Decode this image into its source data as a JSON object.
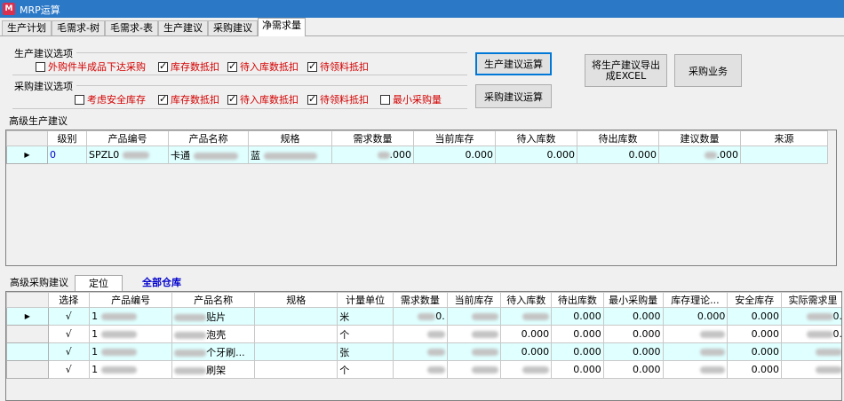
{
  "window": {
    "title": "MRP运算",
    "logo": "M"
  },
  "tabs": [
    "生产计划",
    "毛需求-树",
    "毛需求-表",
    "生产建议",
    "采购建议",
    "净需求量"
  ],
  "active_tab": 5,
  "production_options": {
    "label": "生产建议选项",
    "items": [
      {
        "label": "外购件半成品下达采购",
        "checked": false
      },
      {
        "label": "库存数抵扣",
        "checked": true
      },
      {
        "label": "待入库数抵扣",
        "checked": true
      },
      {
        "label": "待领料抵扣",
        "checked": true
      }
    ]
  },
  "purchase_options": {
    "label": "采购建议选项",
    "items": [
      {
        "label": "考虑安全库存",
        "checked": false
      },
      {
        "label": "库存数抵扣",
        "checked": true
      },
      {
        "label": "待入库数抵扣",
        "checked": true
      },
      {
        "label": "待领料抵扣",
        "checked": true
      },
      {
        "label": "最小采购量",
        "checked": false
      }
    ]
  },
  "buttons": {
    "prod_calc": "生产建议运算",
    "purch_calc": "采购建议运算",
    "export_line1": "将生产建议导出",
    "export_line2": "成EXCEL",
    "purchase_biz": "采购业务"
  },
  "prod_grid": {
    "title": "高级生产建议",
    "columns": [
      "级别",
      "产品编号",
      "产品名称",
      "规格",
      "需求数量",
      "当前库存",
      "待入库数",
      "待出库数",
      "建议数量",
      "来源"
    ],
    "rows": [
      {
        "level": "0",
        "code": "SPZL0",
        "name": "卡通",
        "spec": "蓝",
        "demand": ".000",
        "stock": "0.000",
        "in": "0.000",
        "out": "0.000",
        "advice": ".000",
        "source": ""
      }
    ]
  },
  "bottom_tabs": [
    "高级采购建议",
    "定位",
    "全部仓库"
  ],
  "purch_grid": {
    "columns": [
      "选择",
      "产品编号",
      "产品名称",
      "规格",
      "计量单位",
      "需求数量",
      "当前库存",
      "待入库数",
      "待出库数",
      "最小采购量",
      "库存理论...",
      "安全库存",
      "实际需求里"
    ],
    "rows": [
      {
        "sel": "√",
        "code": "1",
        "name": "贴片",
        "spec": "",
        "unit": "米",
        "demand": "0.",
        "stock": "",
        "in": "",
        "out": "0.000",
        "min": "0.000",
        "theory": "0.000",
        "safe": "0.000",
        "actual": "0."
      },
      {
        "sel": "√",
        "code": "1",
        "name": "泡壳",
        "spec": "",
        "unit": "个",
        "demand": "",
        "stock": "",
        "in": "0.000",
        "out": "0.000",
        "min": "0.000",
        "theory": "",
        "safe": "0.000",
        "actual": "0."
      },
      {
        "sel": "√",
        "code": "1",
        "name": "个牙刷...",
        "spec": "",
        "unit": "张",
        "demand": "",
        "stock": "",
        "in": "0.000",
        "out": "0.000",
        "min": "0.000",
        "theory": "",
        "safe": "0.000",
        "actual": ""
      },
      {
        "sel": "√",
        "code": "1",
        "name": "刷架",
        "spec": "",
        "unit": "个",
        "demand": "",
        "stock": "",
        "in": "",
        "out": "0.000",
        "min": "0.000",
        "theory": "",
        "safe": "0.000",
        "actual": ""
      }
    ]
  },
  "colors": {
    "titlebar": "#2b78c7",
    "option_red": "#d40000",
    "row_alt": "#e0ffff",
    "link_blue": "#0000cc"
  }
}
